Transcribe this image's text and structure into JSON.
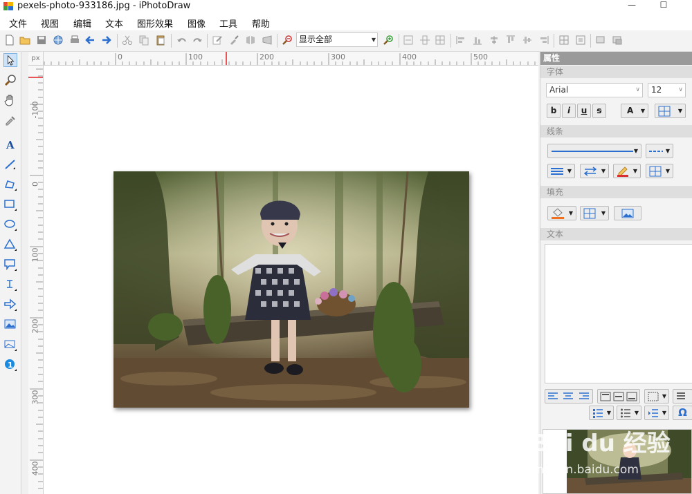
{
  "window": {
    "title": "pexels-photo-933186.jpg - iPhotoDraw",
    "minimize": "—",
    "maximize": "☐"
  },
  "menu": [
    "文件",
    "视图",
    "编辑",
    "文本",
    "图形效果",
    "图像",
    "工具",
    "帮助"
  ],
  "toolbar": {
    "zoom_value": "显示全部"
  },
  "ruler": {
    "unit": "px",
    "h_labels": [
      "0",
      "100",
      "200",
      "300",
      "400",
      "500"
    ],
    "v_labels": [
      "-100",
      "0",
      "100",
      "200",
      "300",
      "400"
    ]
  },
  "properties": {
    "title": "属性",
    "font_section": "字体",
    "font_name": "Arial",
    "font_size": "12",
    "bold": "b",
    "italic": "i",
    "underline": "u",
    "strike": "s",
    "font_color": "A",
    "line_section": "线条",
    "fill_section": "填充",
    "text_section": "文本"
  },
  "watermark": {
    "brand": "Bai du 经验",
    "url": "jingyan.baidu.com"
  },
  "colors": {
    "accent_blue": "#2a6fd0",
    "panel_header": "#9a9a9a",
    "ruler_marker": "#e02020"
  }
}
